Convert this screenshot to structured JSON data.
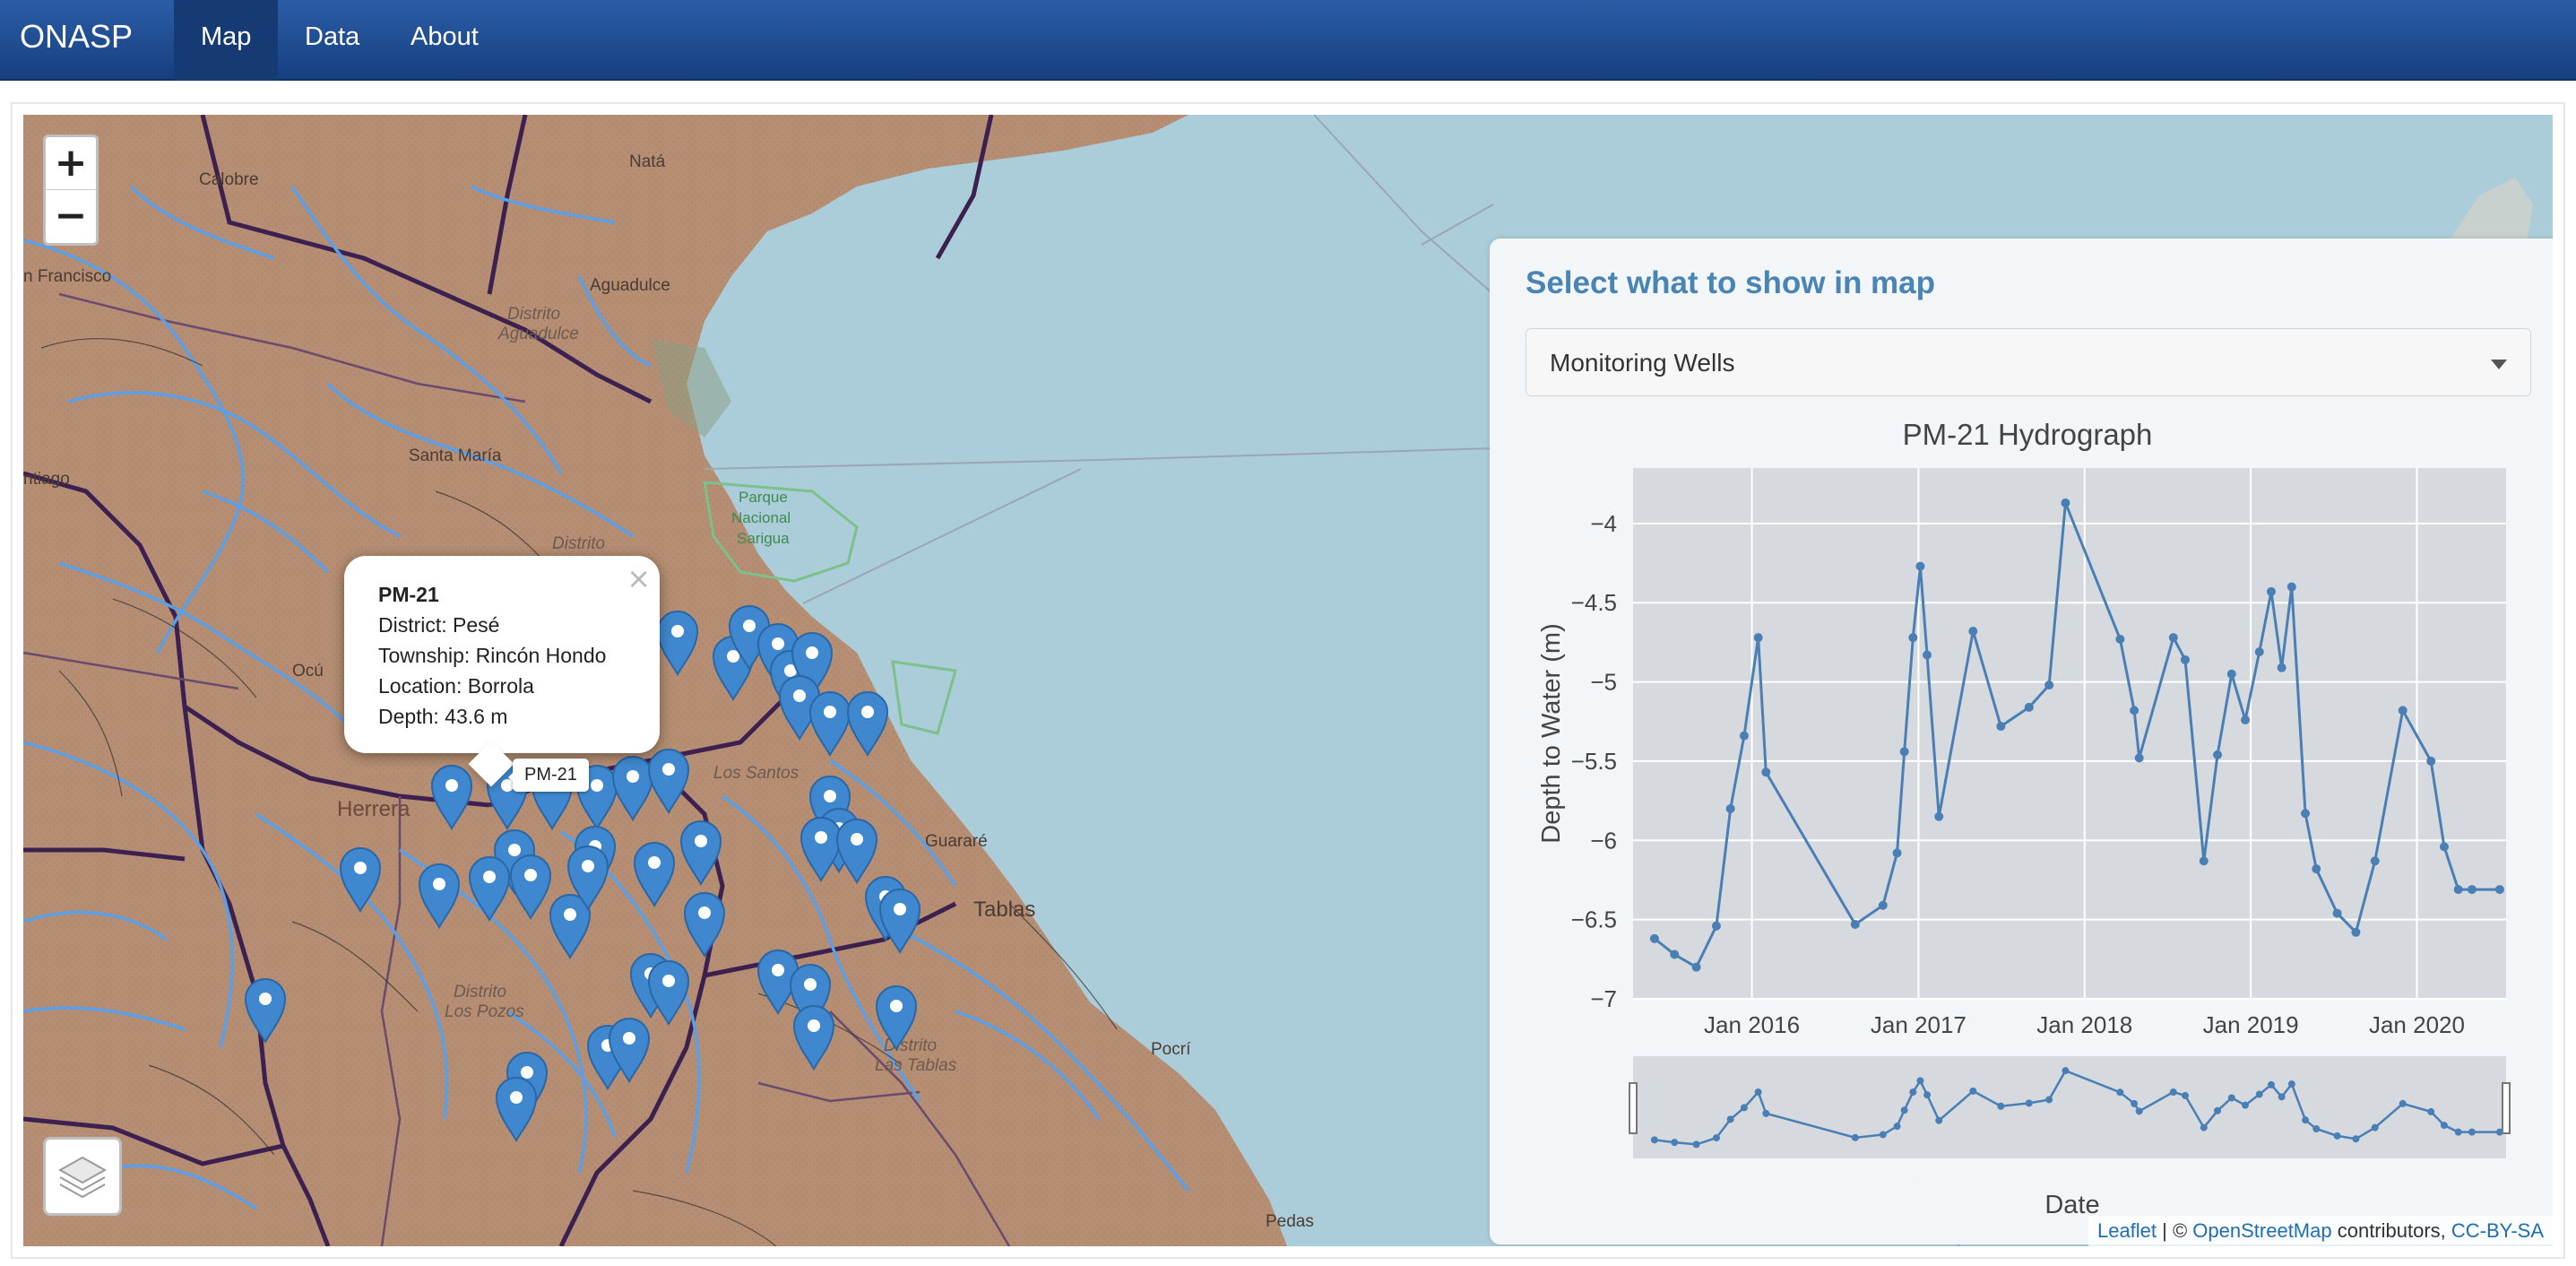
{
  "navbar": {
    "brand": "ONASP",
    "items": [
      {
        "label": "Map",
        "active": true
      },
      {
        "label": "Data",
        "active": false
      },
      {
        "label": "About",
        "active": false
      }
    ]
  },
  "map": {
    "zoom_in": "+",
    "zoom_out": "−",
    "layers_icon": "layers-icon",
    "place_labels": [
      {
        "text": "Natá"
      },
      {
        "text": "Calobre"
      },
      {
        "text": "n Francisco"
      },
      {
        "text": "Aguadulce"
      },
      {
        "text": "Distrito"
      },
      {
        "text": "Aguadulce"
      },
      {
        "text": "Santa María"
      },
      {
        "text": "ntiago"
      },
      {
        "text": "Parque"
      },
      {
        "text": "Nacional"
      },
      {
        "text": "Sarigua"
      },
      {
        "text": "Distrito"
      },
      {
        "text": "Ocú"
      },
      {
        "text": "Herrera"
      },
      {
        "text": "Los Santos"
      },
      {
        "text": "Guararé"
      },
      {
        "text": "Tablas"
      },
      {
        "text": "Distrito"
      },
      {
        "text": "Los Pozos"
      },
      {
        "text": "Distrito"
      },
      {
        "text": "Las Tablas"
      },
      {
        "text": "Pocrí"
      },
      {
        "text": "Pedas"
      }
    ],
    "popup": {
      "title": "PM-21",
      "lines": [
        "District: Pesé",
        "Township: Rincón Hondo",
        "Location: Borrola",
        "Depth: 43.6 m"
      ],
      "close": "×"
    },
    "tooltip": "PM-21",
    "attribution": {
      "leaflet": "Leaflet",
      "sep": " | © ",
      "osm": "OpenStreetMap",
      "contributors": " contributors, ",
      "license": "CC-BY-SA"
    },
    "colors": {
      "land": "#b58e73",
      "water": "#abcdd9",
      "river": "#5b9fe6",
      "border": "#3c2150",
      "marker": "#3f88cf"
    }
  },
  "panel": {
    "title": "Select what to show in map",
    "select_value": "Monitoring Wells"
  },
  "chart_data": {
    "type": "line",
    "title": "PM-21 Hydrograph",
    "xlabel": "Date",
    "ylabel": "Depth to Water (m)",
    "xticks": [
      "Jan 2016",
      "Jan 2017",
      "Jan 2018",
      "Jan 2019",
      "Jan 2020"
    ],
    "yticks": [
      -4,
      -4.5,
      -5,
      -5.5,
      -6,
      -6.5,
      -7
    ],
    "ylim": [
      -7,
      -3.65
    ],
    "xlim": [
      "2015-04-15",
      "2020-07-15"
    ],
    "color": "#4a7fb5",
    "series": [
      {
        "x": [
          "2015-06-01",
          "2015-07-15",
          "2015-09-01",
          "2015-10-15",
          "2015-11-15",
          "2015-12-15",
          "2016-01-15",
          "2016-02-01",
          "2016-08-15",
          "2016-10-15",
          "2016-11-15",
          "2016-12-01",
          "2016-12-20",
          "2017-01-05",
          "2017-01-20",
          "2017-02-15",
          "2017-05-01",
          "2017-07-01",
          "2017-09-01",
          "2017-10-15",
          "2017-11-20",
          "2018-03-20",
          "2018-04-20",
          "2018-05-01",
          "2018-07-15",
          "2018-08-10",
          "2018-09-20",
          "2018-10-20",
          "2018-11-20",
          "2018-12-20",
          "2019-01-20",
          "2019-02-15",
          "2019-03-10",
          "2019-04-01",
          "2019-05-01",
          "2019-05-25",
          "2019-07-10",
          "2019-08-20",
          "2019-10-01",
          "2019-12-01",
          "2020-02-01",
          "2020-03-01",
          "2020-04-01",
          "2020-05-01",
          "2020-07-01"
        ],
        "y": [
          -6.62,
          -6.72,
          -6.8,
          -6.54,
          -5.8,
          -5.34,
          -4.72,
          -5.57,
          -6.53,
          -6.41,
          -6.08,
          -5.44,
          -4.72,
          -4.27,
          -4.83,
          -5.85,
          -4.68,
          -5.28,
          -5.16,
          -5.02,
          -3.87,
          -4.73,
          -5.18,
          -5.48,
          -4.72,
          -4.86,
          -6.13,
          -5.46,
          -4.95,
          -5.24,
          -4.81,
          -4.43,
          -4.91,
          -4.4,
          -5.83,
          -6.18,
          -6.46,
          -6.58,
          -6.13,
          -5.18,
          -5.5,
          -6.04,
          -6.31,
          -6.31,
          -6.31
        ]
      }
    ]
  }
}
